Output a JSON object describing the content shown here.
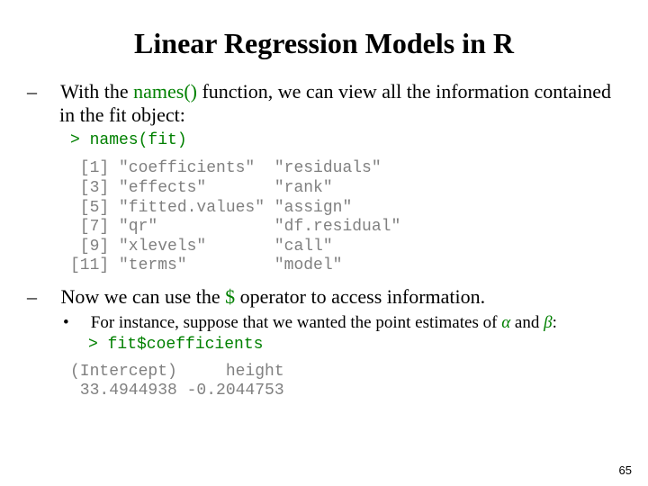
{
  "title": "Linear Regression Models in R",
  "bullet1_pre": "With the ",
  "bullet1_fn": "names()",
  "bullet1_post": " function, we can view all the information contained in the fit object:",
  "code_names_call": "> names(fit)",
  "names_output": " [1] \"coefficients\"  \"residuals\"\n [3] \"effects\"       \"rank\"\n [5] \"fitted.values\" \"assign\"\n [7] \"qr\"            \"df.residual\"\n [9] \"xlevels\"       \"call\"\n[11] \"terms\"         \"model\"",
  "bullet2_pre": "Now we can use the ",
  "bullet2_op": "$",
  "bullet2_post": " operator to access information.",
  "bullet3_pre": "For instance, suppose that we wanted the point estimates of ",
  "bullet3_a": "α",
  "bullet3_mid": " and ",
  "bullet3_b": "β",
  "bullet3_post": ":",
  "code_coef_call": "> fit$coefficients",
  "coef_output": "(Intercept)     height\n 33.4944938 -0.2044753",
  "pagenum": "65",
  "chart_data": {
    "type": "table",
    "title": "fit$coefficients",
    "columns": [
      "(Intercept)",
      "height"
    ],
    "values": [
      33.4944938,
      -0.2044753
    ]
  }
}
